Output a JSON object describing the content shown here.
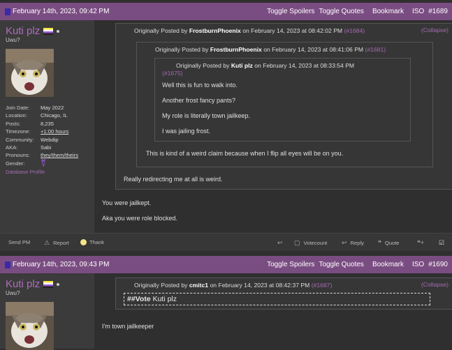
{
  "post1": {
    "date": "February 14th, 2023, 09:42 PM",
    "header_links": [
      "Toggle Spoilers",
      "Toggle Quotes",
      "Bookmark",
      "ISO",
      "#1689"
    ],
    "user": {
      "name": "Kuti plz",
      "title": "Uwu?",
      "details": [
        {
          "label": "Join Date:",
          "value": "May 2022"
        },
        {
          "label": "Location:",
          "value": "Chicago, IL"
        },
        {
          "label": "Posts:",
          "value": "8,235"
        },
        {
          "label": "Timezone:",
          "value": "+1:00 hours"
        },
        {
          "label": "Community:",
          "value": "Webdip"
        },
        {
          "label": "AKA:",
          "value": "Sabi"
        },
        {
          "label": "Pronouns:",
          "value": "they/them/theirs"
        },
        {
          "label": "Gender:",
          "value": ""
        }
      ],
      "db_link": "Database Profile"
    },
    "quote_outer": {
      "prefix": "Originally Posted by",
      "author": "FrostburnPhoenix",
      "on": "on February 14, 2023 at 08:42:02 PM",
      "ref": "(#1684)",
      "collapse": "(Collapse)"
    },
    "quote_mid": {
      "prefix": "Originally Posted by",
      "author": "FrostburnPhoenix",
      "on": "on February 14, 2023 at 08:41:06 PM",
      "ref": "(#1681)"
    },
    "quote_inner": {
      "prefix": "Originally Posted by",
      "author": "Kuti plz",
      "on": "on February 14, 2023 at 08:33:54 PM",
      "ref": "(#1675)",
      "lines": [
        "Well this is fun to walk into.",
        "Another frost fancy pants?",
        "My role is literally town jailkeep.",
        "I was jailing frost."
      ]
    },
    "mid_text": "This is kind of a weird claim because when I flip all eyes will be on you.",
    "outer_text": "Really redirecting me at all is weird.",
    "body": [
      "You were jailkept.",
      "Aka you were role blocked."
    ],
    "actions": {
      "send_pm": "Send PM",
      "report": "Report",
      "thank": "Thank",
      "votecount": "Votecount",
      "reply": "Reply",
      "quote": "Quote"
    }
  },
  "post2": {
    "date": "February 14th, 2023, 09:43 PM",
    "header_links": [
      "Toggle Spoilers",
      "Toggle Quotes",
      "Bookmark",
      "ISO",
      "#1690"
    ],
    "user": {
      "name": "Kuti plz",
      "title": "Uwu?"
    },
    "quote": {
      "prefix": "Originally Posted by",
      "author": "cmitc1",
      "on": "on February 14, 2023 at 08:42:37 PM",
      "ref": "(#1687)",
      "collapse": "(Collapse)",
      "vote_tag": "##Vote",
      "vote_target": "Kuti plz"
    },
    "body": "I'm town jailkeeper"
  }
}
